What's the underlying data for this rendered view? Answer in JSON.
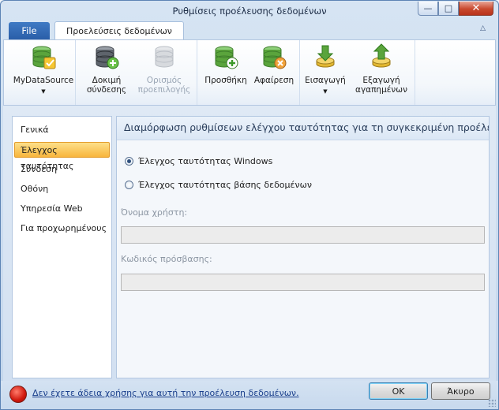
{
  "window": {
    "title": "Ρυθμίσεις προέλευσης δεδομένων",
    "min_glyph": "—",
    "max_glyph": "□",
    "close_glyph": "✕"
  },
  "ribbon": {
    "file_tab": "File",
    "active_tab": "Προελεύσεις δεδομένων",
    "collapse_glyph": "△",
    "buttons": [
      {
        "line1": "MyDataSource",
        "line2": "",
        "icon": "database-check-icon",
        "has_dropdown": true,
        "enabled": true
      },
      {
        "line1": "Δοκιμή",
        "line2": "σύνδεσης",
        "icon": "database-test-icon",
        "has_dropdown": false,
        "enabled": true
      },
      {
        "line1": "Ορισμός",
        "line2": "προεπιλογής",
        "icon": "database-default-icon",
        "has_dropdown": false,
        "enabled": false
      },
      {
        "line1": "Προσθήκη",
        "line2": "",
        "icon": "database-add-icon",
        "has_dropdown": false,
        "enabled": true
      },
      {
        "line1": "Αφαίρεση",
        "line2": "",
        "icon": "database-remove-icon",
        "has_dropdown": false,
        "enabled": true
      },
      {
        "line1": "Εισαγωγή",
        "line2": "",
        "icon": "import-icon",
        "has_dropdown": true,
        "enabled": true
      },
      {
        "line1": "Εξαγωγή",
        "line2": "αγαπημένων",
        "icon": "export-icon",
        "has_dropdown": false,
        "enabled": true
      }
    ],
    "dropdown_glyph": "▼"
  },
  "nav": {
    "items": [
      {
        "label": "Γενικά",
        "selected": false
      },
      {
        "label": "Έλεγχος ταυτότητας",
        "selected": true
      },
      {
        "label": "Σύνδεση",
        "selected": false
      },
      {
        "label": "Οθόνη",
        "selected": false
      },
      {
        "label": "Υπηρεσία Web",
        "selected": false
      },
      {
        "label": "Για προχωρημένους",
        "selected": false
      }
    ]
  },
  "main": {
    "header": "Διαμόρφωση ρυθμίσεων ελέγχου ταυτότητας για τη συγκεκριμένη προέλει",
    "auth_windows": {
      "label": "Έλεγχος ταυτότητας Windows",
      "checked": true
    },
    "auth_db": {
      "label": "Έλεγχος ταυτότητας βάσης δεδομένων",
      "checked": false
    },
    "username_label": "Όνομα χρήστη:",
    "username_value": "",
    "password_label": "Κωδικός πρόσβασης:",
    "password_value": ""
  },
  "footer": {
    "warning_link": "Δεν έχετε άδεια χρήσης για αυτή την προέλευση δεδομένων.",
    "ok_label": "OK",
    "cancel_label": "Άκυρο"
  },
  "colors": {
    "accent_blue": "#2a5ea8",
    "selection_orange": "#f8b53d",
    "db_green": "#5aa43c",
    "db_gold": "#e3b832",
    "stop_red": "#d0180d"
  }
}
